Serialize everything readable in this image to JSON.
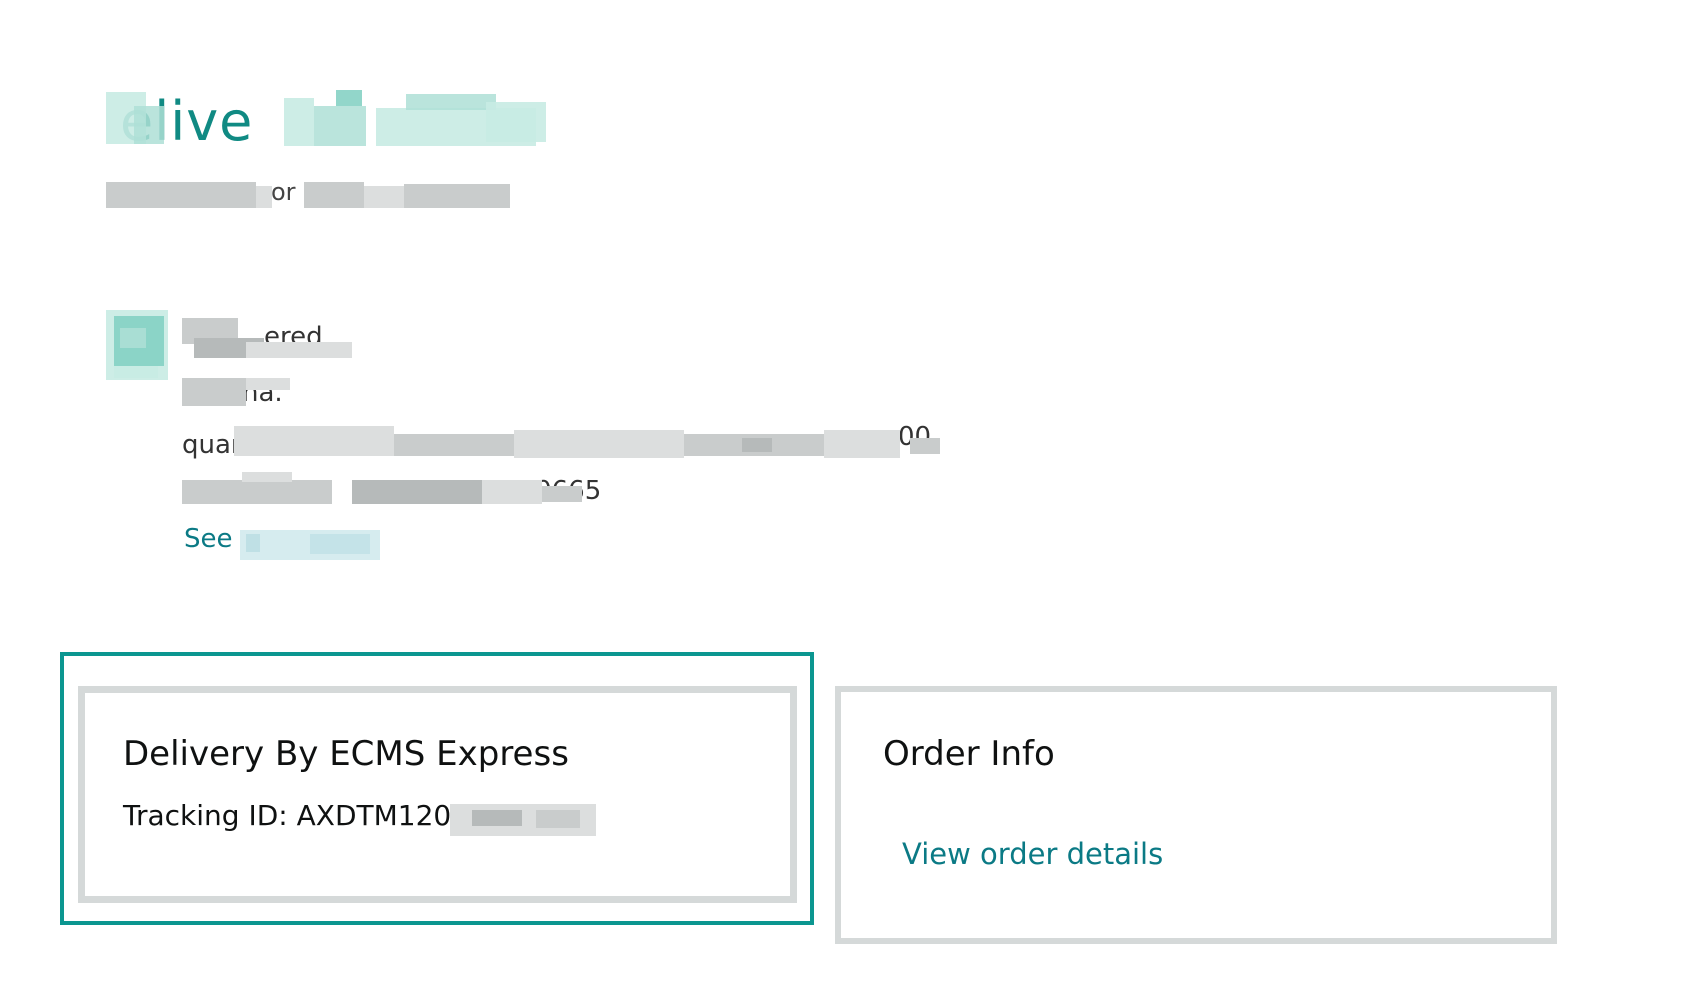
{
  "header": {
    "title_fragment": "elive",
    "subtitle_fragment": "or"
  },
  "status": {
    "line1_fragment": "ered",
    "line2_fragment": "ha.",
    "line3_fragment": "quan",
    "line3_end": "00",
    "line4_end": "510665",
    "see_link_label": "See"
  },
  "delivery_card": {
    "title": "Delivery By ECMS Express",
    "tracking_label": "Tracking ID: AXDTM120"
  },
  "order_card": {
    "title": "Order Info",
    "view_details_label": "View order details"
  },
  "colors": {
    "accent_teal": "#0b9690",
    "link_teal": "#0b7a85",
    "card_border_grey": "#d5d9d9"
  }
}
